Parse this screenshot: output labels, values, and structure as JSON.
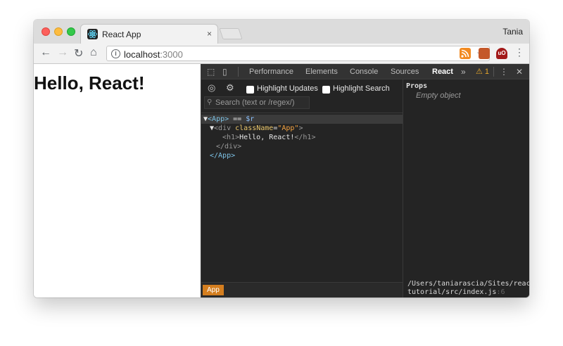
{
  "browser": {
    "tab_title": "React App",
    "tab_close": "×",
    "profile_name": "Tania",
    "url_host": "localhost",
    "url_port": ":3000",
    "nav": {
      "back": "←",
      "forward": "→",
      "reload": "↻",
      "home": "⌂"
    },
    "omnibox_icons": {
      "info": "i",
      "zoom": "⚲",
      "bookmark": "☆"
    },
    "extensions": [
      "rss-icon",
      "image-extension-icon",
      "ublock-icon"
    ],
    "ublock_label": "uO",
    "menu": "⋮"
  },
  "page": {
    "heading": "Hello, React!"
  },
  "devtools": {
    "tabs": [
      "Performance",
      "Elements",
      "Console",
      "Sources",
      "React"
    ],
    "active_tab": "React",
    "more": "»",
    "warning_count": "⚠ 1",
    "menu": "⋮",
    "close": "✕",
    "inspect_icon": "⬚",
    "device_icon": "▯",
    "react": {
      "locate_icon": "◎",
      "settings_icon": "⚙",
      "highlight_updates": "Highlight Updates",
      "highlight_search": "Highlight Search",
      "search_placeholder": "Search (text or /regex/)",
      "search_icon": "⚲",
      "tree": {
        "row1": {
          "caret": "▼",
          "open": "<App>",
          "eq": " == ",
          "ref": "$r"
        },
        "row2": {
          "caret": "▼",
          "open_start": "<div ",
          "attr": "className",
          "eq": "=",
          "val": "\"App\"",
          "open_end": ">"
        },
        "row3": {
          "open": "<h1>",
          "text": "Hello, React!",
          "close": "</h1>"
        },
        "row4": {
          "close": "</div>"
        },
        "row5": {
          "close": "</App>"
        }
      },
      "props_title": "Props",
      "props_empty": "Empty object",
      "source_path": "/Users/taniarascia/Sites/react-tutorial/src/index.js",
      "source_line": ":6",
      "breadcrumb": "App"
    }
  }
}
